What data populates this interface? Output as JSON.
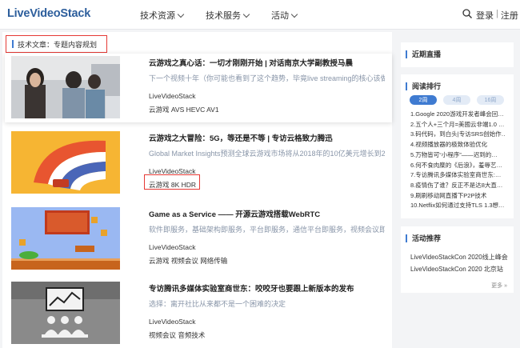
{
  "brand": {
    "logo_text": "LiveVideoStack"
  },
  "nav": {
    "items": [
      "技术资源",
      "技术服务",
      "活动"
    ]
  },
  "auth": {
    "login": "登录",
    "sep": "|",
    "register": "注册"
  },
  "breadcrumb": {
    "text": "技术文章：专题内容规划"
  },
  "articles": [
    {
      "title": "云游戏之真心话：一切才刚刚开始 | 对话南京大学副教授马晨",
      "summary": "下一个视频十年（你可能也看到了这个趋势，毕竟live streaming的核心该做",
      "source": "LiveVideoStack",
      "tags": "云游戏  AVS  HEVC  AV1"
    },
    {
      "title": "云游戏之大冒险：5G，等还是不等 | 专访云格致力腾迅",
      "summary": "Global Market Insights预测全球云游戏市场将从2018年的10亿美元增长到2",
      "source": "LiveVideoStack",
      "tags": "云游戏  8K  HDR"
    },
    {
      "title": "Game as a Service —— 开源云游戏搭载WebRTC",
      "summary": "软件即服务，基础架构即服务，平台即服务，通信平台即服务，视频会议即服",
      "source": "LiveVideoStack",
      "tags": "云游戏  视频会议  网络传输"
    },
    {
      "title": "专访腾讯多媒体实验室商世东：咬咬牙也要跟上新版本的发布",
      "summary": "选择：离开社比从来都不是一个困难的决定",
      "source": "LiveVideoStack",
      "tags": "视频会议  音频技术"
    }
  ],
  "sidebar": {
    "live": {
      "title": "近期直播"
    },
    "ranking": {
      "title": "阅读排行",
      "tabs": [
        "2周",
        "4周",
        "16周"
      ],
      "items": [
        "1.Google 2020游戏开发者峰会回…",
        "2.五个人+三个月=美國云非端1.0 …",
        "3.码代码，到白头|专访SRS创始作…",
        "4.视频播放器的极致体验优化",
        "5.万物皆可“小程序”——迟到的…",
        "6.何不食肉糜的《后浪》，羞辱艺…",
        "7.专访腾讯多媒体实验室商世东:…",
        "8.疫情伤了谁？反正不是达8大直…",
        "9.刷刷移动网直播下P2P技术",
        "10.Netflix如何通过支持TLS 1.3想…"
      ]
    },
    "events": {
      "title": "活动推荐",
      "items": [
        "LiveVideoStackCon 2020线上峰会",
        "LiveVideoStackCon 2020 北京站"
      ],
      "more": "更多 »"
    }
  }
}
